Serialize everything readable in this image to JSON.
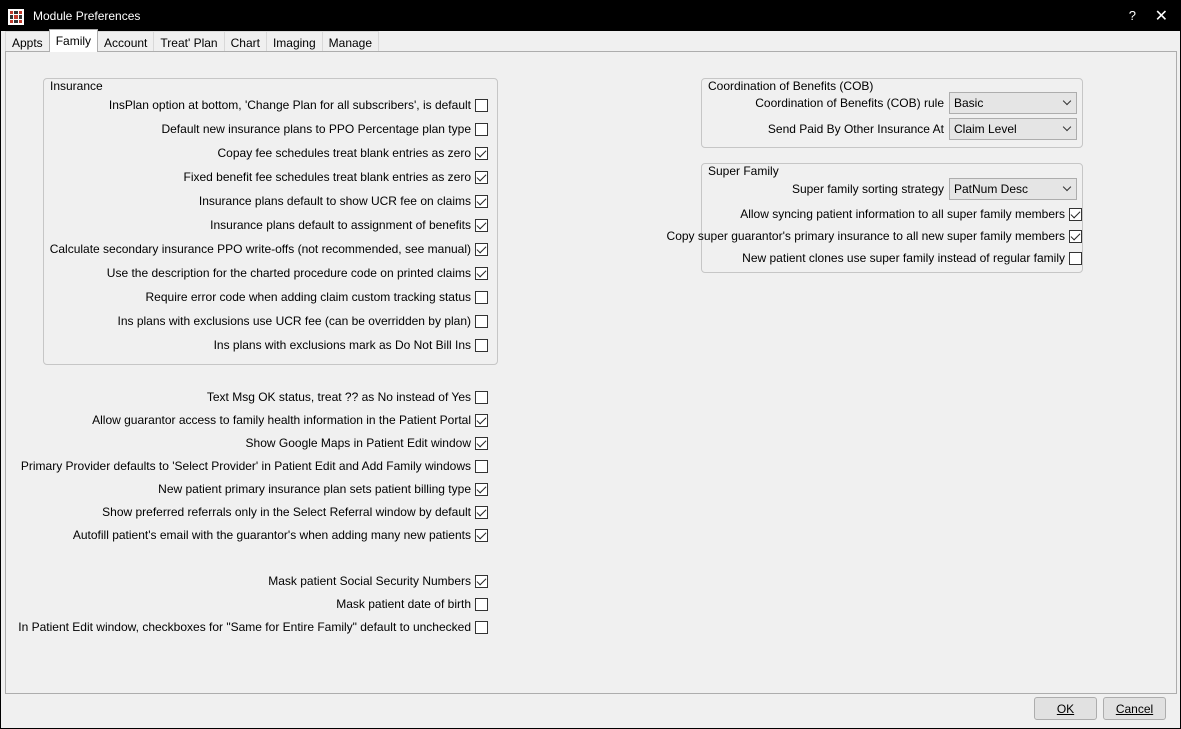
{
  "window": {
    "title": "Module Preferences",
    "help": "?",
    "close": "✕"
  },
  "tabs": [
    "Appts",
    "Family",
    "Account",
    "Treat' Plan",
    "Chart",
    "Imaging",
    "Manage"
  ],
  "active_tab": "Family",
  "insurance": {
    "title": "Insurance",
    "items": [
      {
        "label": "InsPlan option at bottom, 'Change Plan for all subscribers', is default",
        "checked": false
      },
      {
        "label": "Default new insurance plans to PPO Percentage plan type",
        "checked": false
      },
      {
        "label": "Copay fee schedules treat blank entries as zero",
        "checked": true
      },
      {
        "label": "Fixed benefit fee schedules treat blank entries as zero",
        "checked": true
      },
      {
        "label": "Insurance plans default to show UCR fee on claims",
        "checked": true
      },
      {
        "label": "Insurance plans default to assignment of benefits",
        "checked": true
      },
      {
        "label": "Calculate secondary insurance PPO write-offs (not recommended, see manual)",
        "checked": true
      },
      {
        "label": "Use the description for the charted procedure code on printed claims",
        "checked": true
      },
      {
        "label": "Require error code when adding claim custom tracking status",
        "checked": false
      },
      {
        "label": "Ins plans with exclusions use UCR fee (can be overridden by plan)",
        "checked": false
      },
      {
        "label": "Ins plans with exclusions mark as Do Not Bill Ins",
        "checked": false
      }
    ]
  },
  "general": {
    "items": [
      {
        "label": "Text Msg OK status, treat ?? as No instead of Yes",
        "checked": false
      },
      {
        "label": "Allow guarantor access to family health information in the Patient Portal",
        "checked": true
      },
      {
        "label": "Show Google Maps in Patient Edit window",
        "checked": true
      },
      {
        "label": "Primary Provider defaults to 'Select Provider' in Patient Edit and Add Family windows",
        "checked": false
      },
      {
        "label": "New patient primary insurance plan sets patient billing type",
        "checked": true
      },
      {
        "label": "Show preferred referrals only in the Select Referral window by default",
        "checked": true
      },
      {
        "label": "Autofill patient's email with the guarantor's when adding many new patients",
        "checked": true
      }
    ]
  },
  "privacy": {
    "items": [
      {
        "label": "Mask patient Social Security Numbers",
        "checked": true
      },
      {
        "label": "Mask patient date of birth",
        "checked": false
      },
      {
        "label": "In Patient Edit window, checkboxes for \"Same for Entire Family\" default to unchecked",
        "checked": false
      }
    ]
  },
  "cob": {
    "title": "Coordination of Benefits (COB)",
    "rule_label": "Coordination of Benefits (COB) rule",
    "rule_value": "Basic",
    "paid_label": "Send Paid By Other Insurance At",
    "paid_value": "Claim Level"
  },
  "super_family": {
    "title": "Super Family",
    "sort_label": "Super family sorting strategy",
    "sort_value": "PatNum Desc",
    "items": [
      {
        "label": "Allow syncing patient information to all super family members",
        "checked": true
      },
      {
        "label": "Copy super guarantor's primary insurance to all new super family members",
        "checked": true
      },
      {
        "label": "New patient clones use super family instead of regular family",
        "checked": false
      }
    ]
  },
  "buttons": {
    "ok": "OK",
    "cancel": "Cancel"
  }
}
